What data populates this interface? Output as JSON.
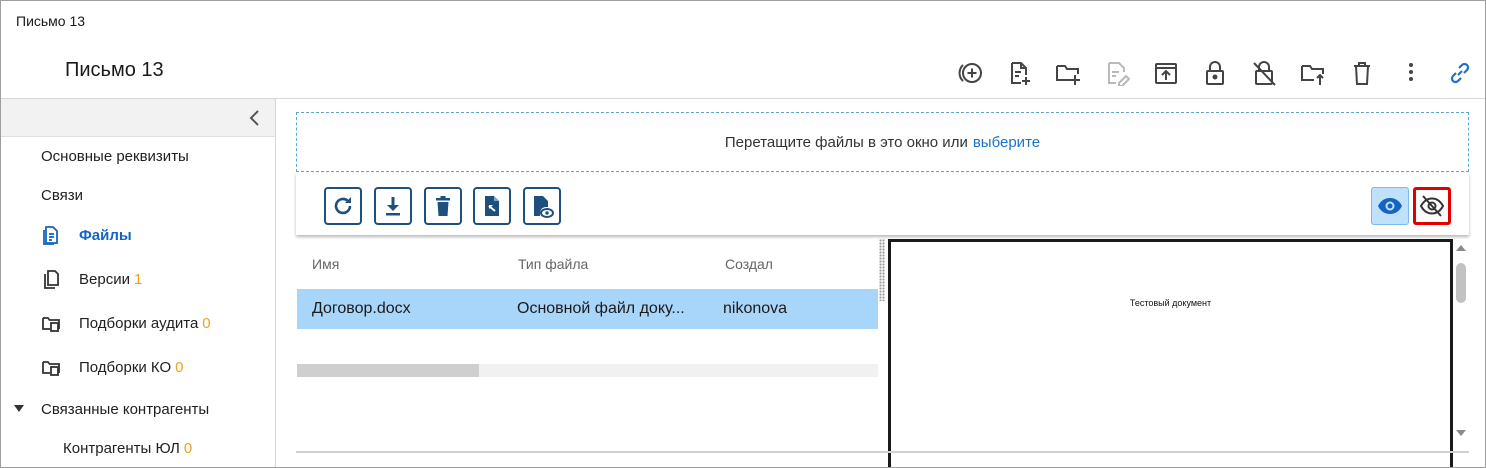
{
  "window": {
    "title": "Письмо 13"
  },
  "header": {
    "doc_title": "Письмо 13",
    "toolbar_icons": [
      "add-circle-icon",
      "new-file-icon",
      "new-folder-icon",
      "edit-file-icon-disabled",
      "upload-icon",
      "lock-icon",
      "unlock-icon",
      "move-folder-icon",
      "trash-icon",
      "more-vert-icon",
      "link-icon"
    ]
  },
  "sidebar": {
    "collapse_icon": "chevron-left-icon",
    "items": [
      {
        "label": "Основные реквизиты",
        "count": ""
      },
      {
        "label": "Связи",
        "count": ""
      },
      {
        "label": "Файлы",
        "count": "",
        "active": true
      },
      {
        "label": "Версии",
        "count": "1"
      },
      {
        "label": "Подборки аудита",
        "count": "0"
      },
      {
        "label": "Подборки КО",
        "count": "0"
      },
      {
        "label": "Связанные контрагенты",
        "count": "",
        "expanded": true
      },
      {
        "label": "Контрагенты ЮЛ",
        "count": "0"
      }
    ]
  },
  "dropzone": {
    "text": "Перетащите файлы в это окно или",
    "link": "выберите"
  },
  "files_toolbar": {
    "buttons": [
      "refresh-icon",
      "download-icon",
      "delete-icon",
      "replace-file-icon",
      "file-preview-icon"
    ],
    "view_on_icon": "eye-icon",
    "view_off_icon": "eye-off-icon",
    "accent": "#1f4f7d",
    "highlight": "#e00000"
  },
  "grid": {
    "columns": [
      "Имя",
      "Тип файла",
      "Создал"
    ],
    "rows": [
      {
        "name": "Договор.docx",
        "type": "Основной файл доку...",
        "author": "nikonova",
        "selected": true
      }
    ]
  },
  "preview": {
    "text": "Тестовый документ"
  }
}
